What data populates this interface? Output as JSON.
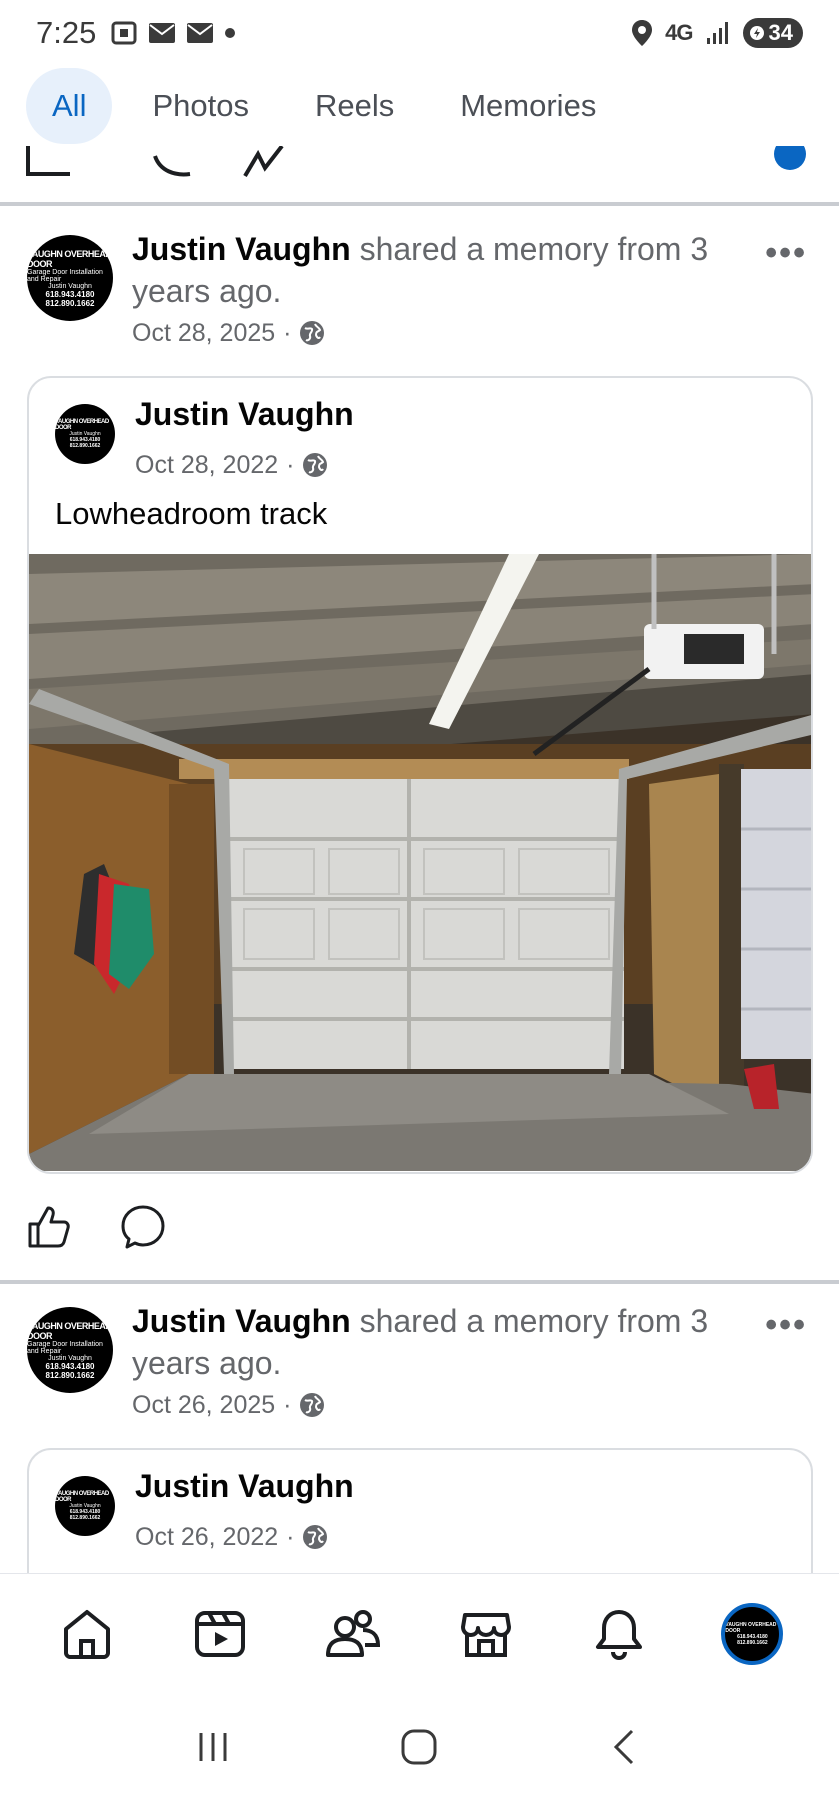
{
  "status_bar": {
    "time": "7:25",
    "network": "4G",
    "battery": "34"
  },
  "tabs": [
    {
      "label": "All",
      "active": true
    },
    {
      "label": "Photos",
      "active": false
    },
    {
      "label": "Reels",
      "active": false
    },
    {
      "label": "Memories",
      "active": false
    }
  ],
  "posts": [
    {
      "author": "Justin Vaughn",
      "shared_text": "shared a memory from 3 years ago.",
      "date": "Oct 28, 2025",
      "card": {
        "author": "Justin Vaughn",
        "date": "Oct 28, 2022",
        "caption": "Lowheadroom track"
      }
    },
    {
      "author": "Justin Vaughn",
      "shared_text": "shared a memory from 3 years ago.",
      "date": "Oct 26, 2025",
      "card": {
        "author": "Justin Vaughn",
        "date": "Oct 26, 2022"
      }
    }
  ],
  "avatar_text": {
    "line1": "VAUGHN OVERHEAD DOOR",
    "line2": "Garage Door Installation and Repair",
    "line3": "Justin Vaughn",
    "phone1": "618.943.4180",
    "phone2": "812.890.1662"
  },
  "more_label": "•••",
  "colors": {
    "accent": "#0a66c2",
    "secondary_text": "#65676b",
    "divider": "#c9ccd1"
  }
}
